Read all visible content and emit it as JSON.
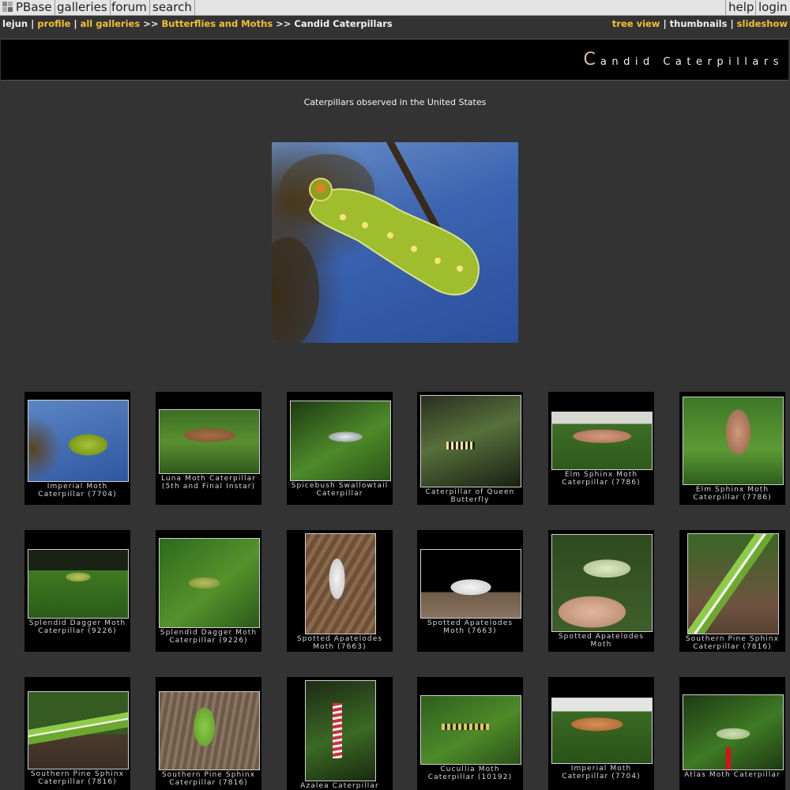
{
  "menu": {
    "logo": "PBase",
    "items": [
      "galleries",
      "forum",
      "search"
    ],
    "right_items": [
      "help",
      "login"
    ]
  },
  "breadcrumb": {
    "user": "lejun",
    "profile": "profile",
    "all_galleries": "all galleries",
    "separator_pipe": "|",
    "separator_arrow": ">>",
    "parent_gallery": "Butterflies and Moths",
    "current": "Candid Caterpillars"
  },
  "view_nav": {
    "tree_view": "tree view",
    "thumbnails": "thumbnails",
    "slideshow": "slideshow",
    "separator": "|"
  },
  "banner": {
    "title_first_letter": "C",
    "title_rest": "andid Caterpillars"
  },
  "description": "Caterpillars observed in the United States",
  "thumbnails": [
    {
      "caption": "Imperial Moth Caterpillar (7704)"
    },
    {
      "caption": "Luna Moth Caterpillar (5th and Final Instar)"
    },
    {
      "caption": "Spicebush Swallowtail Caterpillar"
    },
    {
      "caption": "Caterpillar of Queen Butterfly"
    },
    {
      "caption": "Elm Sphinx Moth Caterpillar (7786)"
    },
    {
      "caption": "Elm Sphinx Moth Caterpillar (7786)"
    },
    {
      "caption": "Splendid Dagger Moth Caterpillar (9226)"
    },
    {
      "caption": "Splendid Dagger Moth Caterpillar (9226)"
    },
    {
      "caption": "Spotted Apatelodes Moth (7663)"
    },
    {
      "caption": "Spotted Apatelodes Moth (7663)"
    },
    {
      "caption": "Spotted Apatelodes Moth"
    },
    {
      "caption": "Southern Pine Sphinx Caterpillar (7816)"
    },
    {
      "caption": "Southern Pine Sphinx Caterpillar (7816)"
    },
    {
      "caption": "Southern Pine Sphinx Caterpillar (7816)"
    },
    {
      "caption": "Azalea Caterpillar"
    },
    {
      "caption": "Cucullia Moth Caterpillar (10192)"
    },
    {
      "caption": "Imperial Moth Caterpillar (7704)"
    },
    {
      "caption": "Atlas Moth Caterpillar"
    }
  ]
}
